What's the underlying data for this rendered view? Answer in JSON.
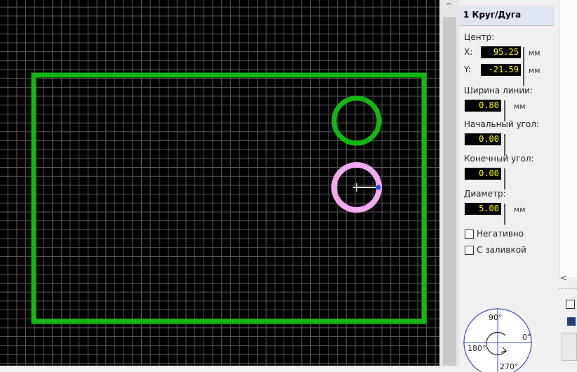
{
  "header": {
    "title": "1 Круг/Дуга"
  },
  "center": {
    "label": "Центр:",
    "x_label": "X:",
    "x_value": "95.25",
    "y_label": "Y:",
    "y_value": "-21.59",
    "unit": "мм"
  },
  "line_width": {
    "label": "Ширина линии:",
    "value": "0.80",
    "unit": "мм"
  },
  "start_angle": {
    "label": "Начальный угол:",
    "value": "0.00"
  },
  "end_angle": {
    "label": "Конечный угол:",
    "value": "0.00"
  },
  "diameter": {
    "label": "Диаметр:",
    "value": "5.00",
    "unit": "мм"
  },
  "options": {
    "negative_label": "Негативно",
    "fill_label": "С заливкой"
  },
  "angle_dial": {
    "deg90": "90°",
    "deg0": "0°",
    "deg180": "180°",
    "deg270": "270°"
  },
  "colors": {
    "board_outline": "#11b811",
    "selected_circle": "#f0a8f0",
    "circle": "#11b811",
    "grid": "#5a5a5a",
    "canvas_bg": "#000000",
    "value_text": "#ffff00"
  }
}
